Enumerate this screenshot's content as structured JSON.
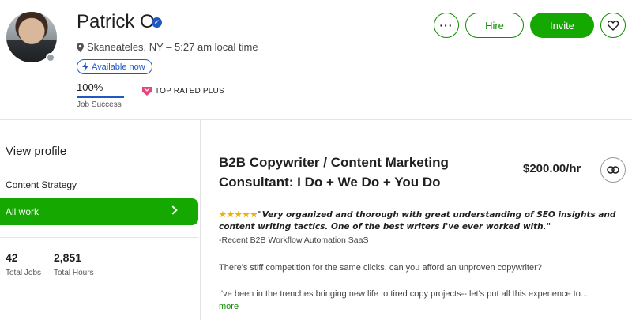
{
  "profile": {
    "name": "Patrick O.",
    "location": "Skaneateles, NY – 5:27 am local time",
    "availability": "Available now",
    "job_success_value": "100%",
    "job_success_label": "Job Success",
    "job_success_fraction": 1.0,
    "badge": "TOP RATED PLUS"
  },
  "actions": {
    "more": "···",
    "hire": "Hire",
    "invite": "Invite"
  },
  "sidebar": {
    "view_profile": "View profile",
    "items": [
      {
        "label": "Content Strategy"
      },
      {
        "label": "All work",
        "active": true
      }
    ],
    "stats": [
      {
        "value": "42",
        "label": "Total Jobs"
      },
      {
        "value": "2,851",
        "label": "Total Hours"
      }
    ]
  },
  "main": {
    "title": "B2B Copywriter / Content Marketing Consultant: I Do + We Do + You Do",
    "rate": "$200.00/hr",
    "review_stars": "★★★★★",
    "review_quote": "\"Very organized and thorough with great understanding of SEO insights and content writing tactics. One of the best writers I've ever worked with.\"",
    "review_attribution": "-Recent B2B Workflow Automation SaaS",
    "para1": "There's stiff competition for the same clicks, can you afford an unproven copywriter?",
    "para2": "I've been in the trenches bringing new life to tired copy projects-- let's put all this experience to...",
    "more_link": "more"
  },
  "colors": {
    "brand_green": "#14a800",
    "link_green": "#108a00",
    "accent_blue": "#1f57c3",
    "star_gold": "#f0b400",
    "badge_pink": "#e8447a"
  },
  "icons": [
    "verified-icon",
    "location-pin-icon",
    "lightning-icon",
    "top-rated-plus-icon",
    "heart-icon",
    "chevron-right-icon",
    "link-icon"
  ]
}
